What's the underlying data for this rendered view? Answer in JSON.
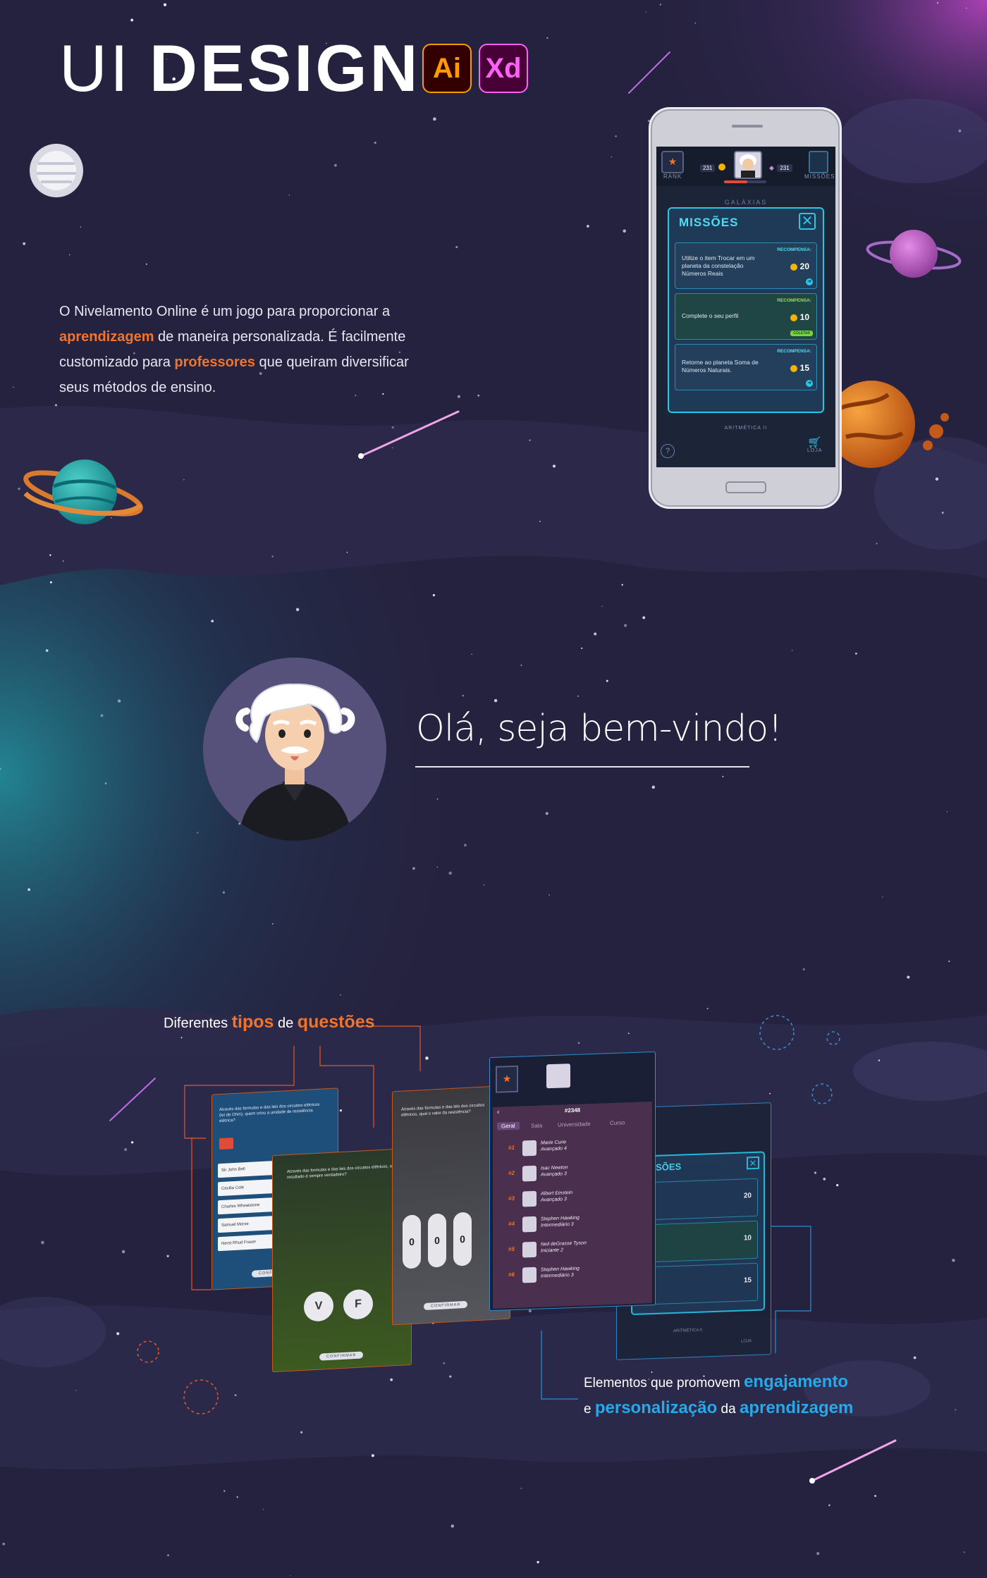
{
  "header": {
    "title_light": "UI",
    "title_bold": "DESIGN",
    "tools": [
      {
        "label": "Ai",
        "name": "Adobe Illustrator"
      },
      {
        "label": "Xd",
        "name": "Adobe XD"
      }
    ]
  },
  "intro": {
    "line1_a": "O Nivelamento Online é um jogo para proporcionar a",
    "hl1": "aprendizagem",
    "line2_rest": " de maneira personalizada. É facilmente",
    "line3_a": "customizado para ",
    "hl2": "professores",
    "line3_rest": " que queiram diversificar",
    "line4": "seus métodos de ensino."
  },
  "phone": {
    "rank_label": "RANK",
    "missions_label": "MISSÕES",
    "coins": "231",
    "gems": "231",
    "galaxies": "GALÁXIAS",
    "modal_title": "MISSÕES",
    "reward_label": "RECOMPENSA:",
    "missions": [
      {
        "text": "Utilize o item Trocar em um planeta da constelação Números Reais",
        "reward": "20",
        "status": ""
      },
      {
        "text": "Complete o seu perfil",
        "reward": "10",
        "status": "COLETAR"
      },
      {
        "text": "Retorne ao planeta Soma de Números Naturais.",
        "reward": "15",
        "status": ""
      }
    ],
    "planet_label": "ARITMÉTICA II",
    "shop_label": "LOJA",
    "help": "?"
  },
  "welcome": {
    "text": "Olá, seja bem-vindo!"
  },
  "captions": {
    "left_a": "Diferentes ",
    "left_b": "tipos",
    "left_c": " de ",
    "left_d": "questões",
    "right_a": "Elementos que promovem ",
    "right_b": "engajamento",
    "right_c": "e ",
    "right_d": "personalização",
    "right_e": " da ",
    "right_f": "aprendizagem"
  },
  "mini_screens": {
    "choice_options": [
      "Sir John Bell",
      "Cecilia Cole",
      "Charles Wheatstone",
      "Samuel Morse",
      "Nerst Rhud Fraser"
    ],
    "confirm": "CONFIRMAR",
    "true_label": "V",
    "false_label": "F",
    "digits": [
      "0",
      "0",
      "0"
    ],
    "ranking_title": "#2348",
    "ranking_tabs": [
      "Geral",
      "Sala",
      "Universidade",
      "Curso"
    ],
    "ranking": [
      {
        "pos": "#1",
        "name": "Marie Curie",
        "level": "Avançado 4"
      },
      {
        "pos": "#2",
        "name": "Isac Newton",
        "level": "Avançado 3"
      },
      {
        "pos": "#3",
        "name": "Albert Einstein",
        "level": "Avançado 3"
      },
      {
        "pos": "#4",
        "name": "Stephen Hawking",
        "level": "Intermediário 3"
      },
      {
        "pos": "#5",
        "name": "Neil deGrasse Tyson",
        "level": "Iniciante 2"
      },
      {
        "pos": "#6",
        "name": "Stephen Hawking",
        "level": "Intermediário 3"
      }
    ]
  },
  "colors": {
    "background": "#25223f",
    "accent_orange": "#f0742c",
    "accent_blue": "#25a9e8",
    "modal_cyan": "#27c7e7"
  }
}
